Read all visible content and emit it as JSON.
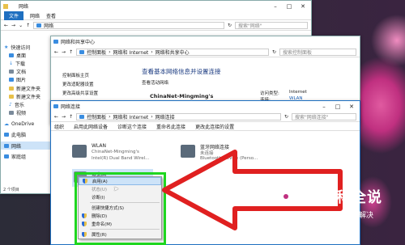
{
  "explorer": {
    "title": "网络",
    "ribbon_tabs": [
      "文件",
      "网络",
      "查看"
    ],
    "address": "网络",
    "search_placeholder": "搜索\"网络\"",
    "nav_items": [
      {
        "label": "快速访问",
        "icon": "star-icon"
      },
      {
        "label": "桌面",
        "icon": "desktop-icon"
      },
      {
        "label": "下载",
        "icon": "download-icon"
      },
      {
        "label": "文档",
        "icon": "document-icon"
      },
      {
        "label": "图片",
        "icon": "picture-icon"
      },
      {
        "label": "新建文件夹",
        "icon": "folder-icon"
      },
      {
        "label": "新建文件夹",
        "icon": "folder-icon"
      },
      {
        "label": "音乐",
        "icon": "music-icon"
      },
      {
        "label": "视频",
        "icon": "video-icon"
      },
      {
        "label": "OneDrive",
        "icon": "cloud-icon"
      },
      {
        "label": "此电脑",
        "icon": "computer-icon"
      },
      {
        "label": "网络",
        "icon": "network-icon"
      },
      {
        "label": "家庭组",
        "icon": "homegroup-icon"
      }
    ],
    "status": "2 个项目"
  },
  "sharing_center": {
    "title": "网络和共享中心",
    "breadcrumb": [
      "控制面板",
      "网络和 Internet",
      "网络和共享中心"
    ],
    "search_placeholder": "搜索控制面板",
    "left_links": [
      "控制面板主页",
      "更改适配器设置",
      "更改高级共享设置"
    ],
    "heading": "查看基本网络信息并设置连接",
    "subheading": "查看活动网络",
    "network_name": "ChinaNet-Mingming's",
    "access_type_label": "访问类型:",
    "access_type_value": "Internet",
    "connections_label": "连接:",
    "connections_value": "WLAN"
  },
  "connections": {
    "title": "网络连接",
    "breadcrumb": [
      "控制面板",
      "网络和 Internet",
      "网络连接"
    ],
    "search_placeholder": "搜索\"网络连接\"",
    "toolbar": [
      "组织",
      "启用此网络设备",
      "诊断这个连接",
      "重命名此连接",
      "更改此连接的设置"
    ],
    "adapters": [
      {
        "name": "WLAN",
        "line1": "ChinaNet-Mingming's",
        "line2": "Intel(R) Dual Band Wirel...",
        "icon": "wifi-adapter-icon"
      },
      {
        "name": "蓝牙网络连接",
        "line1": "未连接",
        "line2": "Bluetooth Device (Perso...",
        "icon": "bluetooth-adapter-icon"
      },
      {
        "name": "以太网",
        "line1": "",
        "line2": "",
        "icon": "ethernet-adapter-icon"
      }
    ]
  },
  "context_menu": {
    "items": [
      {
        "label": "启用(A)",
        "shield": true,
        "highlight": true,
        "disabled": false
      },
      {
        "label": "状态(U)",
        "shield": false,
        "highlight": false,
        "disabled": true
      },
      {
        "label": "诊断(I)",
        "shield": false,
        "highlight": false,
        "disabled": false
      },
      {
        "label": "创建快捷方式(S)",
        "shield": false,
        "highlight": false,
        "disabled": false
      },
      {
        "label": "删除(D)",
        "shield": true,
        "highlight": false,
        "disabled": false
      },
      {
        "label": "重命名(M)",
        "shield": true,
        "highlight": false,
        "disabled": false
      },
      {
        "label": "属性(R)",
        "shield": true,
        "highlight": false,
        "disabled": false
      }
    ]
  },
  "watermark": {
    "title": "百科全说",
    "subtitle": "助你轻松解决"
  },
  "colors": {
    "accent": "#1e6fc0",
    "highlight_box": "#1fd620",
    "arrow": "#e02020"
  }
}
